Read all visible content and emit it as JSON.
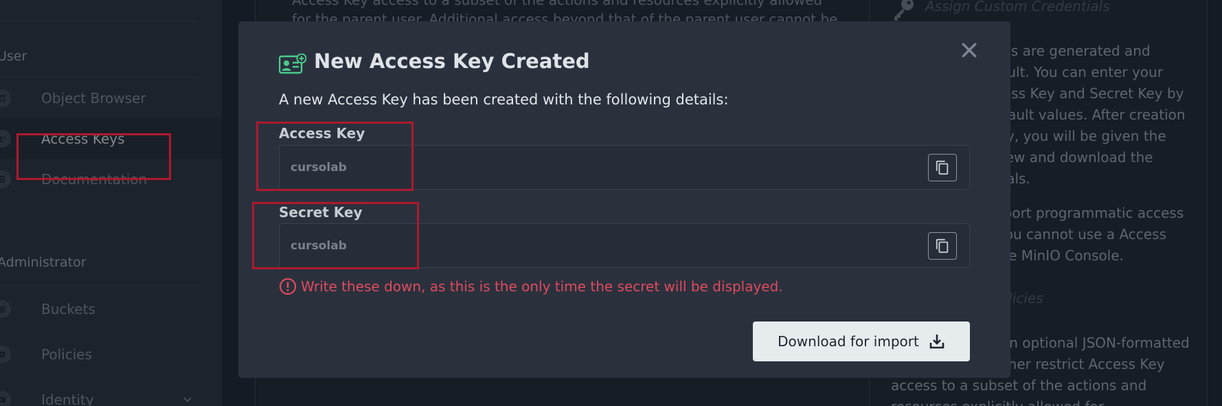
{
  "sidebar": {
    "section_user": "User",
    "section_admin": "Administrator",
    "items": [
      {
        "label": "Object Browser",
        "icon": "object-browser-icon"
      },
      {
        "label": "Access Keys",
        "icon": "access-keys-icon",
        "active": true
      },
      {
        "label": "Documentation",
        "icon": "documentation-icon"
      },
      {
        "label": "Buckets",
        "icon": "buckets-icon"
      },
      {
        "label": "Policies",
        "icon": "policies-icon"
      },
      {
        "label": "Identity",
        "icon": "identity-icon"
      }
    ]
  },
  "background": {
    "main_text_line1": "Access Key access to a subset of the actions and resources explicitly allowed",
    "main_text_line2": "for the parent user. Additional access beyond that of the parent user cannot be",
    "help_heading_1": "Assign Custom Credentials",
    "help_para_1": "Access credentials are generated and provided by default. You can enter your own custom Access Key and Secret Key by replacing the default values. After creation of any Access Key, you will be given the opportunity to view and download the account credentials.",
    "help_para_2": "Access Keys support programmatic access by design, and you cannot use a Access Key to log into the MinIO Console.",
    "help_heading_2": "Assign Access Policies",
    "help_para_3": "You can specify an optional JSON-formatted IAM policy to further restrict Access Key access to a subset of the actions and resources explicitly allowed for"
  },
  "modal": {
    "title": "New Access Key Created",
    "description": "A new Access Key has been created with the following details:",
    "access_key_label": "Access Key",
    "access_key_value": "cursolab",
    "secret_key_label": "Secret Key",
    "secret_key_value": "cursolab",
    "warning": "Write these down, as this is the only time the secret will be displayed.",
    "download_label": "Download for import"
  },
  "colors": {
    "accent_green": "#4ccb8d",
    "warning_red": "#e14a5e",
    "highlight_red": "#b0192d"
  }
}
